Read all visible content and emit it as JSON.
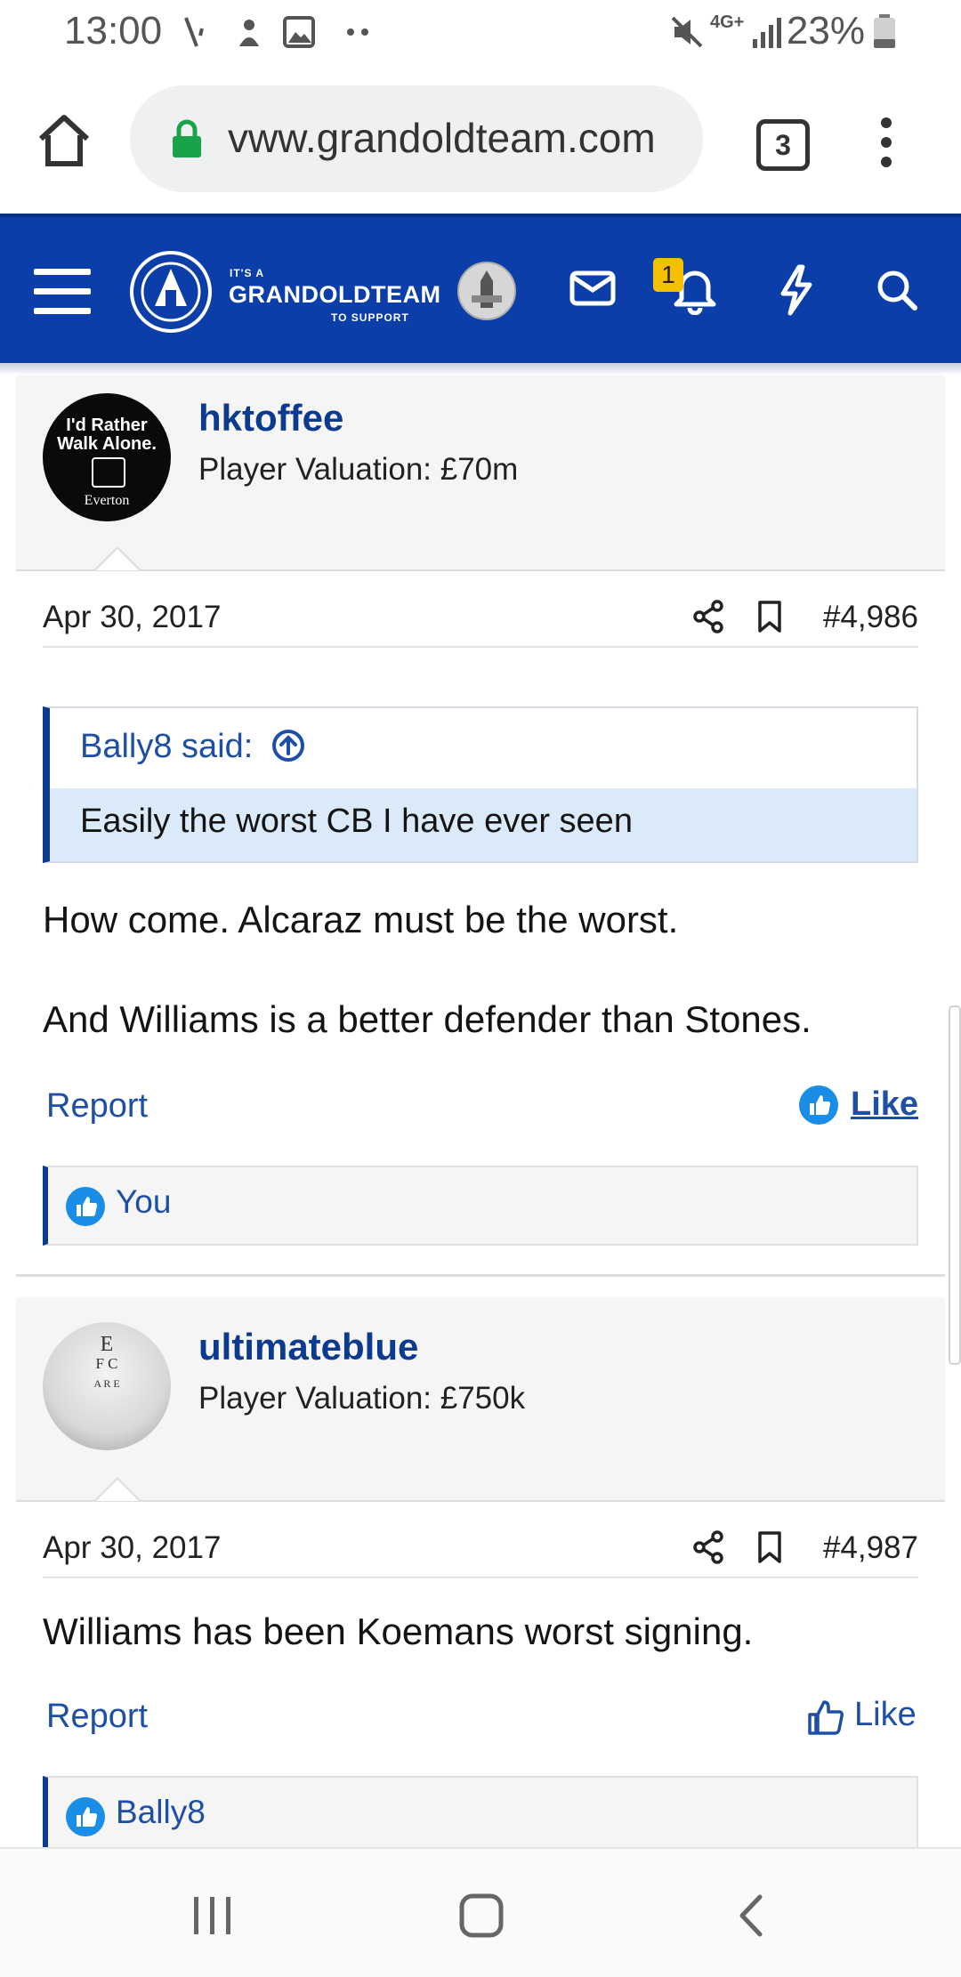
{
  "status_bar": {
    "time": "13:00",
    "network": "4G+",
    "battery": "23%"
  },
  "browser": {
    "url": "vww.grandoldteam.com",
    "tab_count": "3"
  },
  "site_header": {
    "tagline_top": "IT'S A",
    "brand": "GRANDOLDTEAM",
    "tagline_bottom": "TO SUPPORT",
    "alert_count": "1"
  },
  "posts": [
    {
      "username": "hktoffee",
      "valuation": "Player Valuation: £70m",
      "avatar_lines": [
        "I'd Rather",
        "Walk Alone.",
        "Everton"
      ],
      "date": "Apr 30, 2017",
      "post_number": "#4,986",
      "quote": {
        "author": "Bally8 said:",
        "text": "Easily the worst CB I have ever seen"
      },
      "paragraphs": [
        "How come. Alcaraz must be the worst.",
        "And Williams is a better defender than Stones."
      ],
      "report_label": "Report",
      "like_label": "Like",
      "liked_by": "You"
    },
    {
      "username": "ultimateblue",
      "valuation": "Player Valuation: £750k",
      "avatar_lines": [
        "E",
        "F C",
        "A R E"
      ],
      "date": "Apr 30, 2017",
      "post_number": "#4,987",
      "paragraphs": [
        "Williams has been Koemans worst signing."
      ],
      "report_label": "Report",
      "like_label": "Like",
      "liked_by": "Bally8"
    }
  ],
  "colors": {
    "brand_blue": "#0b3ea8",
    "link_blue": "#1d4fa6",
    "quote_bg": "#dbeaf8",
    "like_blue": "#1a8ee6",
    "alert_yellow": "#f5c000"
  }
}
